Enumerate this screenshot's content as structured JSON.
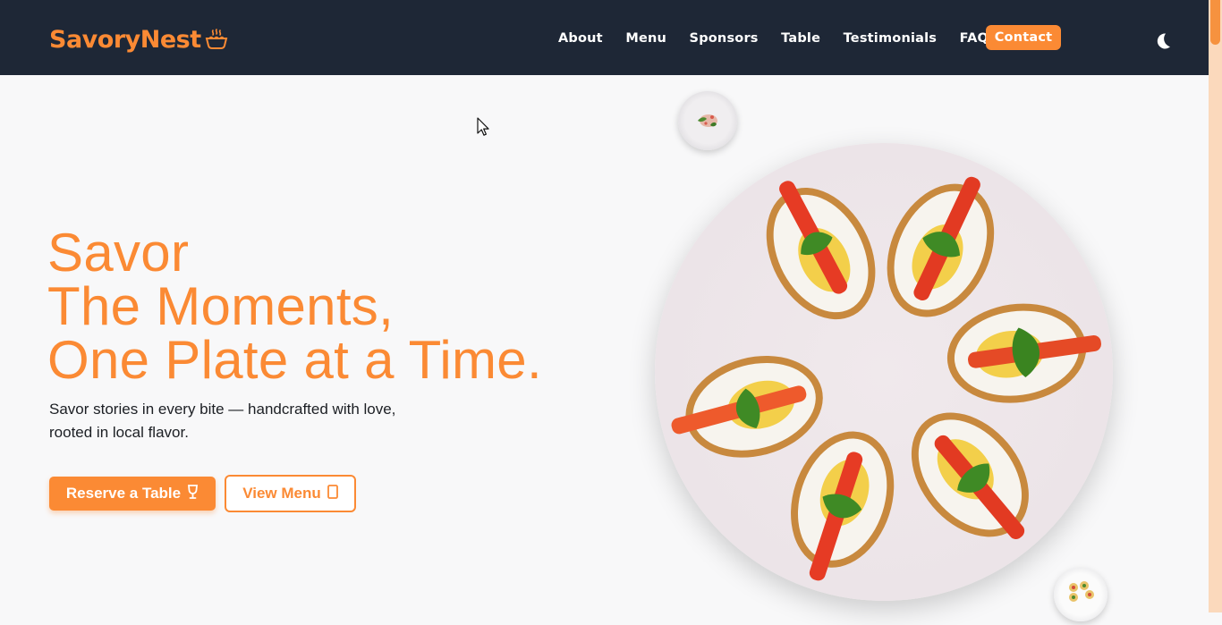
{
  "brand": {
    "name": "SavoryNest",
    "icon": "food-bowl-icon",
    "accent": "#fb8a34",
    "navbar_bg": "#1e2736"
  },
  "nav": {
    "items": [
      {
        "label": "About"
      },
      {
        "label": "Menu"
      },
      {
        "label": "Sponsors"
      },
      {
        "label": "Table"
      },
      {
        "label": "Testimonials"
      },
      {
        "label": "FAQ"
      }
    ],
    "contact_label": "Contact",
    "theme_toggle_icon": "moon-icon"
  },
  "hero": {
    "title_lines": [
      "Savor",
      "The Moments,",
      "One Plate at a Time."
    ],
    "subtitle_line1": "Savor stories in every bite — handcrafted with love,",
    "subtitle_line2": "rooted in local flavor.",
    "primary_button": {
      "label": "Reserve a Table",
      "icon": "wine-glass-icon"
    },
    "secondary_button": {
      "label": "View Menu",
      "icon": "menu-book-icon"
    },
    "main_image": "plate-of-stuffed-eggs-image",
    "thumbnails": [
      "salad-plate-thumbnail",
      "canape-plate-thumbnail"
    ]
  }
}
